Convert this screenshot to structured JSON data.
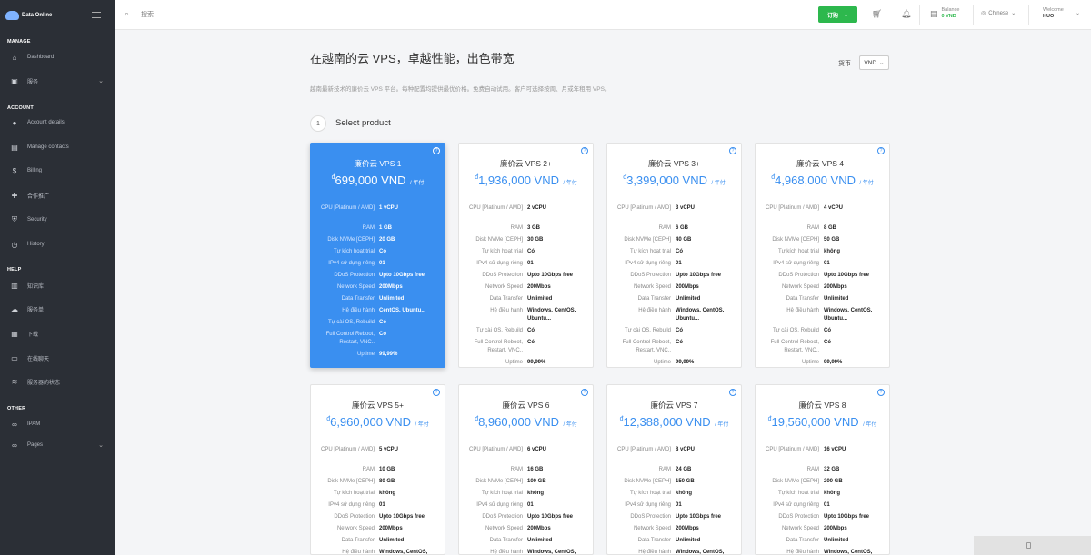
{
  "brand": {
    "name": "Data Online"
  },
  "sidebar": {
    "sections": [
      {
        "label": "MANAGE"
      },
      {
        "label": "ACCOUNT"
      },
      {
        "label": "HELP"
      },
      {
        "label": "OTHER"
      }
    ],
    "items": [
      {
        "label": "Dashboard",
        "icon": "home-icon"
      },
      {
        "label": "服务",
        "icon": "services-icon"
      },
      {
        "label": "Account details",
        "icon": "user-icon"
      },
      {
        "label": "Manage contacts",
        "icon": "contacts-icon"
      },
      {
        "label": "Billing",
        "icon": "dollar-icon"
      },
      {
        "label": "合作推广",
        "icon": "affiliate-icon"
      },
      {
        "label": "Security",
        "icon": "shield-icon"
      },
      {
        "label": "History",
        "icon": "history-icon"
      },
      {
        "label": "知识库",
        "icon": "book-icon"
      },
      {
        "label": "服务单",
        "icon": "ticket-icon"
      },
      {
        "label": "下载",
        "icon": "download-icon"
      },
      {
        "label": "在线聊天",
        "icon": "chat-icon"
      },
      {
        "label": "服务器的状态",
        "icon": "status-icon"
      },
      {
        "label": "IPAM",
        "icon": "link-icon"
      },
      {
        "label": "Pages",
        "icon": "pages-icon"
      }
    ]
  },
  "topbar": {
    "search_placeholder": "搜索",
    "order_label": "订购",
    "balance_label": "Balance",
    "balance_value": "0 VND",
    "language": "Chinese",
    "welcome_label": "Welcome",
    "welcome_user": "HUO"
  },
  "main": {
    "title": "在越南的云 VPS，卓越性能，出色带宽",
    "currency_label": "货币",
    "currency_value": "VND",
    "subtitle": "越南最新技术的廉价云 VPS 平台。每种配置均提供最优价格。免费自动试用。客户可选择按周、月或年租用 VPS。",
    "step_number": "1",
    "step_title": "Select product"
  },
  "spec_labels": {
    "cpu": "CPU [Platinum / AMD]",
    "ram": "RAM",
    "disk": "Disk NVMe [CEPH]",
    "trial": "Tự kích hoạt trial",
    "ipv4": "IPv4 sử dụng riêng",
    "ddos": "DDoS Protection",
    "net": "Network Speed",
    "transfer": "Data Transfer",
    "os": "Hệ điều hành",
    "reinstall": "Tự cài OS, Rebuild",
    "control": "Full Control Reboot, Restart, VNC..",
    "uptime": "Uptime"
  },
  "products": [
    {
      "name": "廉价云 VPS 1",
      "currency_symbol": "đ",
      "price": "699,000 VND",
      "period": "/ 年付",
      "cpu": "1 vCPU",
      "ram": "1 GB",
      "disk": "20 GB",
      "trial": "Có",
      "ipv4": "01",
      "ddos": "Upto 10Gbps free",
      "net": "200Mbps",
      "transfer": "Unlimited",
      "os": "CentOS, Ubuntu...",
      "reinstall": "Có",
      "control": "Có",
      "uptime": "99,99%"
    },
    {
      "name": "廉价云 VPS 2+",
      "currency_symbol": "đ",
      "price": "1,936,000 VND",
      "period": "/ 年付",
      "cpu": "2 vCPU",
      "ram": "3 GB",
      "disk": "30 GB",
      "trial": "Có",
      "ipv4": "01",
      "ddos": "Upto 10Gbps free",
      "net": "200Mbps",
      "transfer": "Unlimited",
      "os": "Windows, CentOS, Ubuntu...",
      "reinstall": "Có",
      "control": "Có",
      "uptime": "99,99%"
    },
    {
      "name": "廉价云 VPS 3+",
      "currency_symbol": "đ",
      "price": "3,399,000 VND",
      "period": "/ 年付",
      "cpu": "3 vCPU",
      "ram": "6 GB",
      "disk": "40 GB",
      "trial": "Có",
      "ipv4": "01",
      "ddos": "Upto 10Gbps free",
      "net": "200Mbps",
      "transfer": "Unlimited",
      "os": "Windows, CentOS, Ubuntu...",
      "reinstall": "Có",
      "control": "Có",
      "uptime": "99,99%"
    },
    {
      "name": "廉价云 VPS 4+",
      "currency_symbol": "đ",
      "price": "4,968,000 VND",
      "period": "/ 年付",
      "cpu": "4 vCPU",
      "ram": "8 GB",
      "disk": "50 GB",
      "trial": "không",
      "ipv4": "01",
      "ddos": "Upto 10Gbps free",
      "net": "200Mbps",
      "transfer": "Unlimited",
      "os": "Windows, CentOS, Ubuntu...",
      "reinstall": "Có",
      "control": "Có",
      "uptime": "99,99%"
    },
    {
      "name": "廉价云 VPS 5+",
      "currency_symbol": "đ",
      "price": "6,960,000 VND",
      "period": "/ 年付",
      "cpu": "5 vCPU",
      "ram": "10 GB",
      "disk": "80 GB",
      "trial": "không",
      "ipv4": "01",
      "ddos": "Upto 10Gbps free",
      "net": "200Mbps",
      "transfer": "Unlimited",
      "os": "Windows, CentOS,",
      "reinstall": "",
      "control": "",
      "uptime": ""
    },
    {
      "name": "廉价云 VPS 6",
      "currency_symbol": "đ",
      "price": "8,960,000 VND",
      "period": "/ 年付",
      "cpu": "6 vCPU",
      "ram": "16 GB",
      "disk": "100 GB",
      "trial": "không",
      "ipv4": "01",
      "ddos": "Upto 10Gbps free",
      "net": "200Mbps",
      "transfer": "Unlimited",
      "os": "Windows, CentOS,",
      "reinstall": "",
      "control": "",
      "uptime": ""
    },
    {
      "name": "廉价云 VPS 7",
      "currency_symbol": "đ",
      "price": "12,388,000 VND",
      "period": "/ 年付",
      "cpu": "8 vCPU",
      "ram": "24 GB",
      "disk": "150 GB",
      "trial": "không",
      "ipv4": "01",
      "ddos": "Upto 10Gbps free",
      "net": "200Mbps",
      "transfer": "Unlimited",
      "os": "Windows, CentOS,",
      "reinstall": "",
      "control": "",
      "uptime": ""
    },
    {
      "name": "廉价云 VPS 8",
      "currency_symbol": "đ",
      "price": "19,560,000 VND",
      "period": "/ 年付",
      "cpu": "16 vCPU",
      "ram": "32 GB",
      "disk": "200 GB",
      "trial": "không",
      "ipv4": "01",
      "ddos": "Upto 10Gbps free",
      "net": "200Mbps",
      "transfer": "Unlimited",
      "os": "Windows, CentOS,",
      "reinstall": "",
      "control": "",
      "uptime": ""
    }
  ],
  "colors": {
    "accent": "#3a8ff0",
    "order_button": "#2db84d",
    "sidebar": "#2b2f36"
  }
}
